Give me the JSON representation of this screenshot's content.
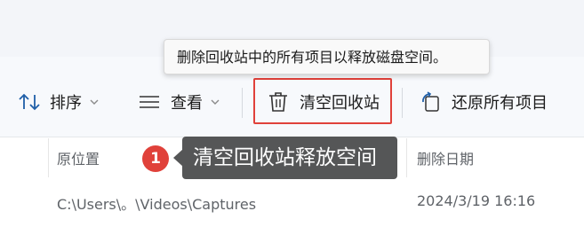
{
  "tooltip": {
    "text": "删除回收站中的所有项目以释放磁盘空间。"
  },
  "toolbar": {
    "sort_label": "排序",
    "view_label": "查看",
    "empty_recycle_bin_label": "清空回收站",
    "restore_all_label": "还原所有项目"
  },
  "annotation": {
    "badge_number": "1",
    "callout_text": "清空回收站释放空间",
    "highlight_color": "#e0413a"
  },
  "columns": {
    "original_location": "原位置",
    "date_deleted": "删除日期"
  },
  "rows": [
    {
      "original_location": "C:\\Users\\。\\Videos\\Captures",
      "date_deleted": "2024/3/19 16:16"
    }
  ]
}
